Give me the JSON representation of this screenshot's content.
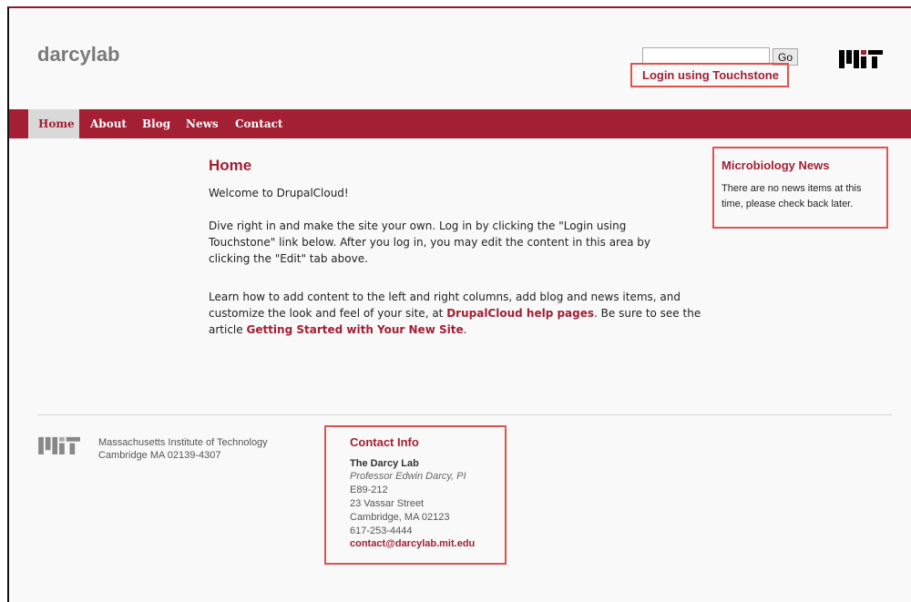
{
  "header": {
    "site_name": "darcylab",
    "search_value": "",
    "go_label": "Go",
    "login_link": "Login using Touchstone"
  },
  "nav": {
    "items": [
      {
        "label": "Home",
        "active": true
      },
      {
        "label": "About"
      },
      {
        "label": "Blog"
      },
      {
        "label": "News"
      },
      {
        "label": "Contact"
      }
    ]
  },
  "main": {
    "title": "Home",
    "welcome": "Welcome to DrupalCloud!",
    "p2_line1": "Dive right in and make the site your own. Log in by clicking the \"Login using",
    "p2_line2": "Touchstone\" link below. After you log in, you may edit the content in this area by",
    "p2_line3": "clicking the \"Edit\" tab above.",
    "p3_line1": "Learn how to add content to the left and right columns, add blog and news items, and",
    "p3_line2_text": "customize the look and feel of your site, at ",
    "help_link": "DrupalCloud help pages",
    "p3_line2_end": ". Be sure to see the",
    "p3_line3_text": "article ",
    "getting_started_link": "Getting Started with Your New Site",
    "p3_line3_end": "."
  },
  "sidebar": {
    "news_title": "Microbiology News",
    "news_text": "There are no news items at this time, please check back later."
  },
  "footer": {
    "org_line1": "Massachusetts Institute of Technology",
    "org_line2": "Cambridge MA 02139-4307",
    "contact_title": "Contact Info",
    "lab_name": "The Darcy Lab",
    "pi": "Professor Edwin Darcy, PI",
    "room": "E89-212",
    "street": "23 Vassar Street",
    "city": "Cambridge, MA 02123",
    "phone": "617-253-4444",
    "email": "contact@darcylab.mit.edu"
  },
  "colors": {
    "brand": "#a31f34",
    "highlight_box": "#e0524f",
    "nav_active_bg": "#d9d9d9"
  }
}
